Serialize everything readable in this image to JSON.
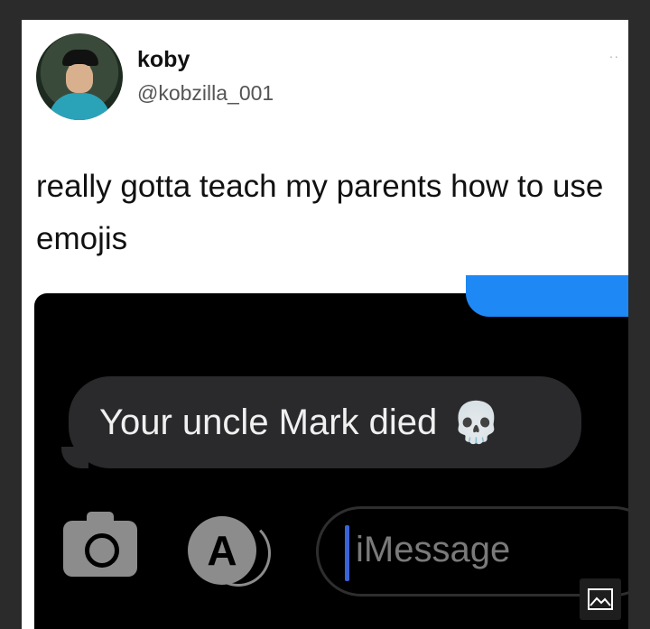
{
  "tweet": {
    "display_name": "koby",
    "handle": "@kobzilla_001",
    "text": "really gotta teach my parents how to use emojis",
    "more_icon": "more-dots-icon"
  },
  "screenshot": {
    "received_message": "Your uncle Mark died",
    "received_emoji": "💀",
    "input_placeholder": "iMessage",
    "camera_icon": "camera-icon",
    "appstore_icon": "appstore-icon",
    "sent_bubble_color": "#1e88f5"
  },
  "overlay": {
    "image_icon": "image-icon"
  }
}
